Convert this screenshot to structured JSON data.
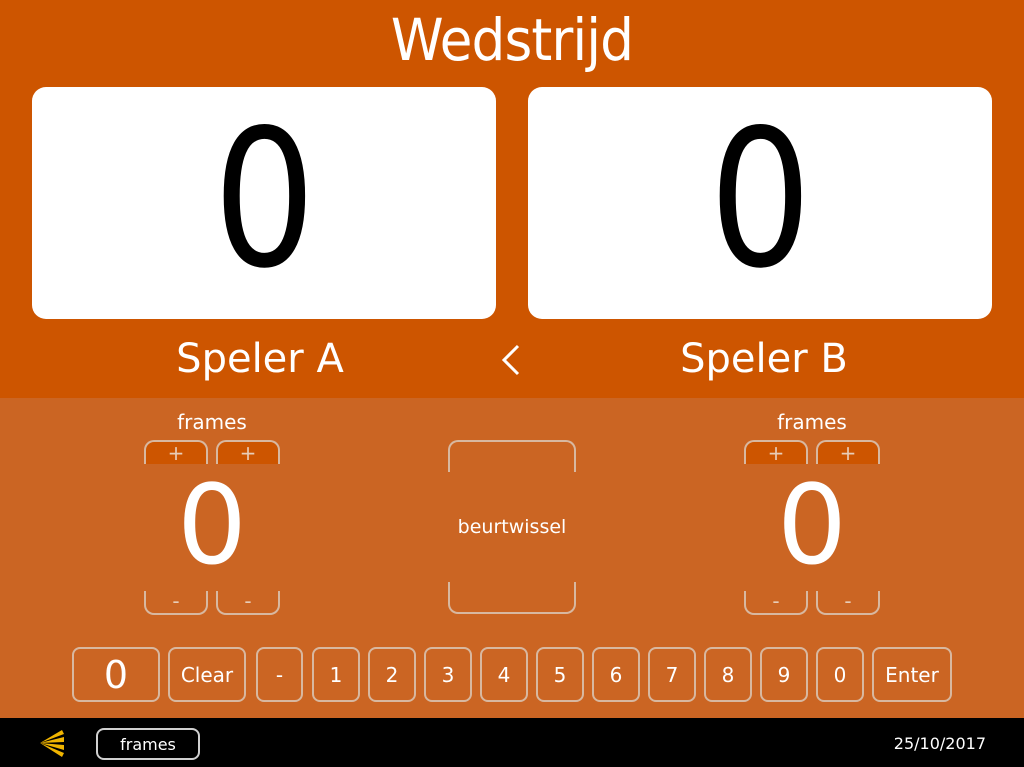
{
  "header": {
    "title": "Wedstrijd"
  },
  "players": [
    {
      "name": "Speler A",
      "score": "0",
      "frames_label": "frames",
      "frames": "0"
    },
    {
      "name": "Speler B",
      "score": "0",
      "frames_label": "frames",
      "frames": "0"
    }
  ],
  "turn_indicator": {
    "icon": "chevron-left-icon",
    "active_player": "Speler A"
  },
  "controls": {
    "plus_label": "+",
    "minus_label": "-",
    "turn_switch_label": "beurtwissel"
  },
  "keypad": {
    "display_value": "0",
    "clear_label": "Clear",
    "minus_label": "-",
    "digits": [
      "1",
      "2",
      "3",
      "4",
      "5",
      "6",
      "7",
      "8",
      "9",
      "0"
    ],
    "enter_label": "Enter"
  },
  "footer": {
    "logo_icon": "logo-icon",
    "mode_button_label": "frames",
    "date": "25/10/2017"
  },
  "colors": {
    "top_background": "#cd5500",
    "panel_background": "#cb6523",
    "footer_background": "#000000",
    "logo_color": "#f0b400"
  }
}
